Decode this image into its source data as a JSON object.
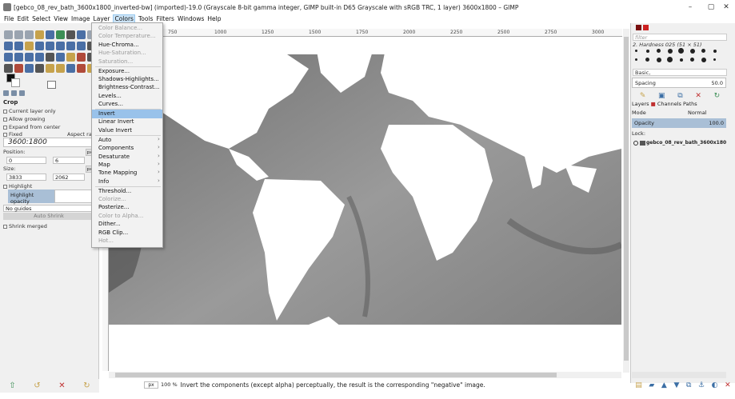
{
  "window": {
    "title": "[gebco_08_rev_bath_3600x1800_inverted-bw] (imported)-19.0 (Grayscale 8-bit gamma integer, GIMP built-in D65 Grayscale with sRGB TRC, 1 layer) 3600x1800 – GIMP",
    "minimize": "–",
    "maximize": "▢",
    "close": "✕"
  },
  "menubar": [
    "File",
    "Edit",
    "Select",
    "View",
    "Image",
    "Layer",
    "Colors",
    "Tools",
    "Filters",
    "Windows",
    "Help"
  ],
  "colors_menu": [
    {
      "label": "Color Balance...",
      "disabled": true
    },
    {
      "label": "Color Temperature...",
      "disabled": true
    },
    {
      "label": "Hue-Chroma...",
      "disabled": false
    },
    {
      "label": "Hue-Saturation...",
      "disabled": true
    },
    {
      "label": "Saturation...",
      "disabled": true
    },
    {
      "label": "Exposure...",
      "disabled": false
    },
    {
      "label": "Shadows-Highlights...",
      "disabled": false
    },
    {
      "label": "Brightness-Contrast...",
      "disabled": false
    },
    {
      "label": "Levels...",
      "disabled": false
    },
    {
      "label": "Curves...",
      "disabled": false
    },
    {
      "label": "Invert",
      "disabled": false,
      "highlighted": true
    },
    {
      "label": "Linear Invert",
      "disabled": false
    },
    {
      "label": "Value Invert",
      "disabled": false
    },
    {
      "label": "Auto",
      "disabled": false,
      "submenu": true
    },
    {
      "label": "Components",
      "disabled": false,
      "submenu": true
    },
    {
      "label": "Desaturate",
      "disabled": false,
      "submenu": true
    },
    {
      "label": "Map",
      "disabled": false,
      "submenu": true
    },
    {
      "label": "Tone Mapping",
      "disabled": false,
      "submenu": true
    },
    {
      "label": "Info",
      "disabled": false,
      "submenu": true
    },
    {
      "label": "Threshold...",
      "disabled": false
    },
    {
      "label": "Colorize...",
      "disabled": true
    },
    {
      "label": "Posterize...",
      "disabled": false
    },
    {
      "label": "Color to Alpha...",
      "disabled": true
    },
    {
      "label": "Dither...",
      "disabled": false
    },
    {
      "label": "RGB Clip...",
      "disabled": false
    },
    {
      "label": "Hot...",
      "disabled": true
    }
  ],
  "tool_options": {
    "title": "Crop",
    "current_layer_only": "Current layer only",
    "allow_growing": "Allow growing",
    "expand_from_center": "Expand from center",
    "fixed": "Fixed",
    "aspect_ratio_mode": "Aspect ratio",
    "ratio": "3600:1800",
    "position_label": "Position:",
    "pos_x": "0",
    "pos_y": "6",
    "size_label": "Size:",
    "size_w": "3833",
    "size_h": "2062",
    "unit": "px",
    "highlight": "Highlight",
    "highlight_opacity": "Highlight opacity",
    "guides": "No guides",
    "auto_shrink": "Auto Shrink",
    "shrink_merged": "Shrink merged"
  },
  "ruler_ticks": [
    "750",
    "1000",
    "1250",
    "1500",
    "1750",
    "2000",
    "2250",
    "2500",
    "2750",
    "3000"
  ],
  "status": {
    "unit": "px",
    "zoom": "100 %",
    "message": "Invert the components (except alpha) perceptually, the result is the corresponding \"negative\" image."
  },
  "dock": {
    "filter_placeholder": "filter",
    "brush_name": "2. Hardness 025 (51 × 51)",
    "brush_category": "Basic,",
    "spacing_label": "Spacing",
    "spacing_value": "50.0",
    "tabs": [
      "Layers",
      "Channels",
      "Paths"
    ],
    "mode_label": "Mode",
    "mode_value": "Normal",
    "opacity_label": "Opacity",
    "opacity_value": "100.0",
    "lock_label": "Lock:",
    "layer_name": "gebco_08_rev_bath_3600x1800_inverted-bw"
  },
  "colors": {
    "menu_highlight": "#99c2ea",
    "options_highlight": "#a9bfd6",
    "ocean_gray": "#8a8a8a",
    "land_white": "#ffffff"
  }
}
